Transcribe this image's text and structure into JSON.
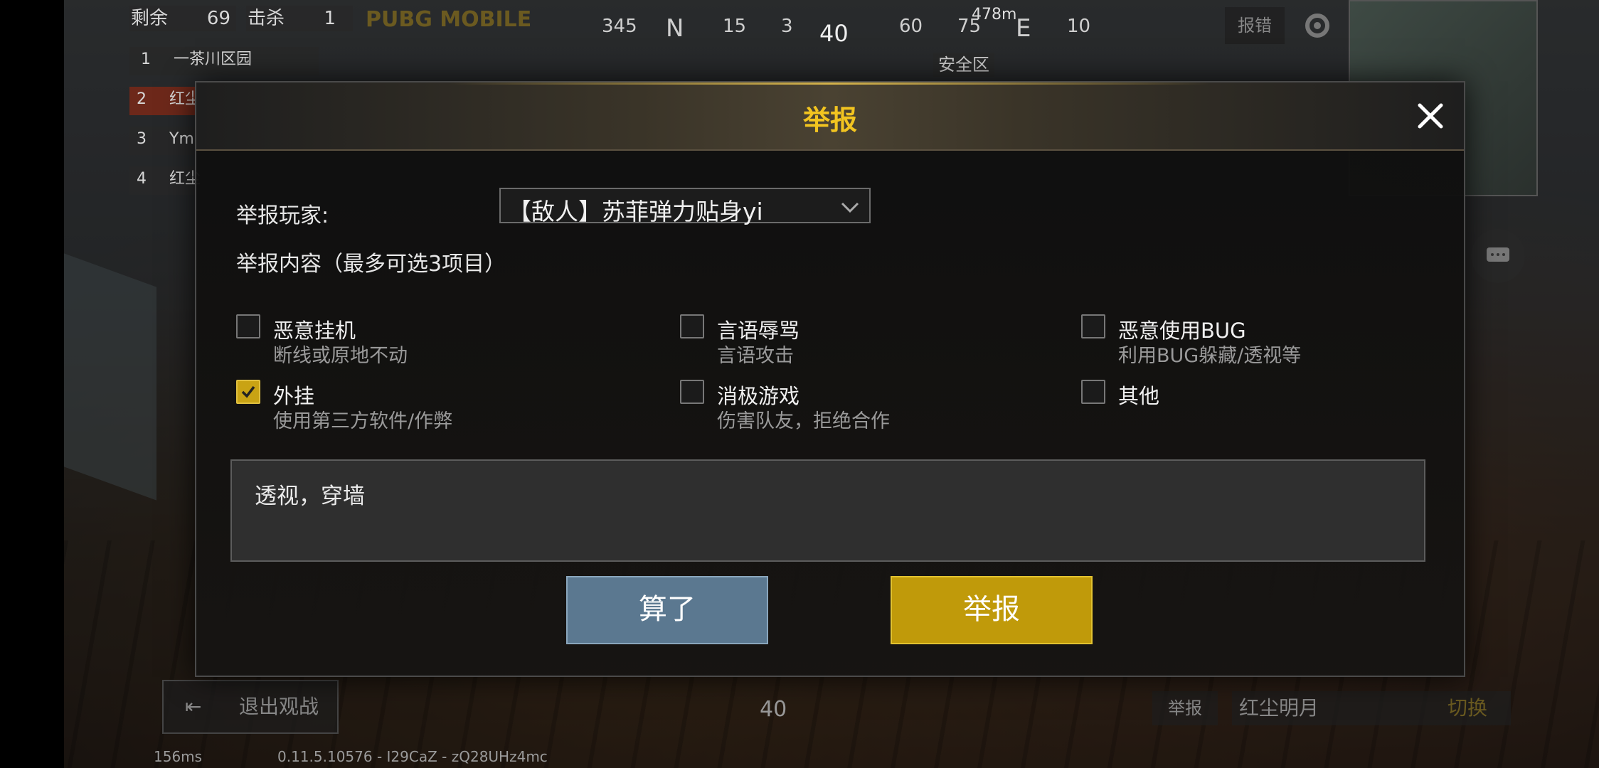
{
  "hud": {
    "remaining_label": "剩余",
    "remaining_value": "69",
    "kills_label": "击杀",
    "kills_value": "1",
    "logo_text": "PUBG MOBILE",
    "compass_marks": [
      "345",
      "N",
      "15",
      "3",
      "40",
      "60",
      "75",
      "E",
      "10"
    ],
    "distance": "478m",
    "safe_zone": "安全区",
    "error_report_button": "报错",
    "team": [
      {
        "num": "1",
        "name": "一茶川区园"
      },
      {
        "num": "2",
        "name": "红尘"
      },
      {
        "num": "3",
        "name": "Ym"
      },
      {
        "num": "4",
        "name": "红尘"
      }
    ]
  },
  "modal": {
    "title": "举报",
    "player_label": "举报玩家:",
    "player_selected": "【敌人】苏菲弹力贴身yi",
    "content_label": "举报内容（最多可选3项目）",
    "options": [
      {
        "title": "恶意挂机",
        "subtitle": "断线或原地不动",
        "checked": false
      },
      {
        "title": "言语辱骂",
        "subtitle": "言语攻击",
        "checked": false
      },
      {
        "title": "恶意使用BUG",
        "subtitle": "利用BUG躲藏/透视等",
        "checked": false
      },
      {
        "title": "外挂",
        "subtitle": "使用第三方软件/作弊",
        "checked": true
      },
      {
        "title": "消极游戏",
        "subtitle": "伤害队友，拒绝合作",
        "checked": false
      },
      {
        "title": "其他",
        "subtitle": "",
        "checked": false
      }
    ],
    "description_value": "透视，穿墙",
    "cancel_label": "算了",
    "submit_label": "举报"
  },
  "bottom": {
    "exit_spectate": "退出观战",
    "ammo": "40",
    "report_small": "举报",
    "spectating_player": "红尘明月",
    "switch_label": "切换",
    "ping": "156ms",
    "build_info": "0.11.5.10576 - I29CaZ - zQ28UHz4mc"
  },
  "colors": {
    "accent_gold": "#f2c420",
    "submit_bg": "#c09a0a",
    "cancel_bg": "#5b7890",
    "checkbox_checked": "#c9a314"
  }
}
